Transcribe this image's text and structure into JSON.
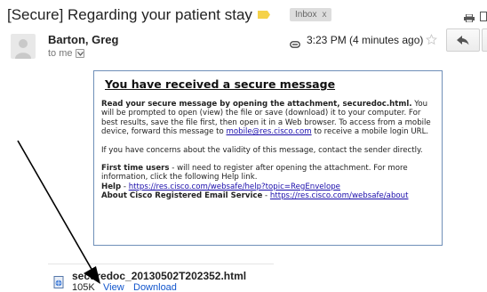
{
  "header": {
    "subject": "[Secure] Regarding your patient stay",
    "label_chip": "Inbox",
    "label_chip_close": "x",
    "important_color": "#f5d24a"
  },
  "message": {
    "sender": "Barton, Greg",
    "recipient": "to me",
    "timestamp": "3:23 PM (4 minutes ago)"
  },
  "secure_box": {
    "heading": "You have received a secure message",
    "para1_bold": "Read your secure message by opening the attachment, securedoc.html.",
    "para1_text": " You will be prompted to open (view) the file or save (download) it to your computer. For best results, save the file first, then open it in a Web browser. To access from a mobile device, forward this message to ",
    "para1_link": "mobile@res.cisco.com",
    "para1_tail": " to receive a mobile login URL.",
    "para2": "If you have concerns about the validity of this message, contact the sender directly.",
    "para3_bold": "First time users",
    "para3_text": " - will need to register after opening the attachment. For more information, click the following Help link.",
    "help_label": "Help",
    "help_sep": " - ",
    "help_link": "https://res.cisco.com/websafe/help?topic=RegEnvelope",
    "about_label": "About Cisco Registered Email Service",
    "about_sep": " - ",
    "about_link": "https://res.cisco.com/websafe/about",
    "border_color": "#6f8fb8",
    "link_color": "#1a0dab"
  },
  "attachment": {
    "filename": "securedoc_20130502T202352.html",
    "size": "105K",
    "view_label": "View",
    "download_label": "Download"
  },
  "icons": {
    "important": "important-marker-icon",
    "print": "print-icon",
    "new_window": "new-window-icon",
    "avatar": "avatar-icon",
    "details": "chevron-down-icon",
    "attachment": "paperclip-icon",
    "star": "star-icon",
    "reply": "reply-icon",
    "file": "html-file-icon",
    "annotation": "arrow-annotation"
  }
}
